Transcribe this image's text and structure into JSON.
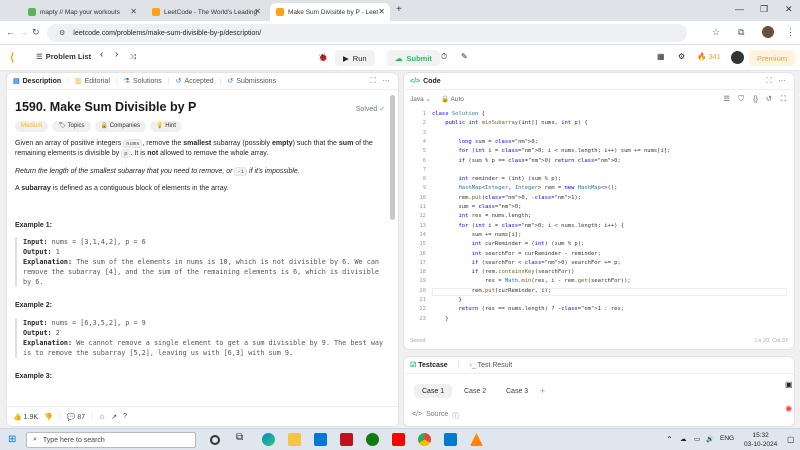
{
  "browser": {
    "tabs": [
      {
        "title": "mapty // Map your workouts",
        "active": false
      },
      {
        "title": "LeetCode - The World's Leading",
        "active": false
      },
      {
        "title": "Make Sum Divisible by P - Leet",
        "active": true
      }
    ],
    "new_tab": "+",
    "url": "leetcode.com/problems/make-sum-divisible-by-p/description/"
  },
  "lc_header": {
    "problem_list": "Problem List",
    "run": "Run",
    "submit": "Submit",
    "streak": "341",
    "premium": "Premium"
  },
  "left_tabs": [
    "Description",
    "Editorial",
    "Solutions",
    "Accepted",
    "Submissions"
  ],
  "problem": {
    "title": "1590. Make Sum Divisible by P",
    "status": "Solved",
    "chips": [
      "Medium",
      "Topics",
      "Companies",
      "Hint"
    ],
    "p1_a": "Given an array of positive integers ",
    "p1_code": "nums",
    "p1_b": ", remove the ",
    "p1_smallest": "smallest",
    "p1_c": " subarray (possibly ",
    "p1_empty": "empty",
    "p1_d": ") such that the ",
    "p1_sum": "sum",
    "p1_e": " of the remaining elements is divisible by ",
    "p1_p": "p",
    "p1_f": ". It is ",
    "p1_not": "not",
    "p1_g": " allowed to remove the whole array.",
    "p2_a": "Return the length of the smallest subarray that you need to remove, or ",
    "p2_code": "-1",
    "p2_b": " if it's impossible.",
    "p3_a": "A ",
    "p3_sub": "subarray",
    "p3_b": " is defined as a contiguous block of elements in the array.",
    "examples": [
      {
        "heading": "Example 1:",
        "input_label": "Input:",
        "input": " nums = [3,1,4,2], p = 6",
        "output_label": "Output:",
        "output": " 1",
        "expl_label": "Explanation:",
        "expl": " The sum of the elements in nums is 10, which is not divisible by 6. We can remove the subarray [4], and the sum of the remaining elements is 6, which is divisible by 6."
      },
      {
        "heading": "Example 2:",
        "input_label": "Input:",
        "input": " nums = [6,3,5,2], p = 9",
        "output_label": "Output:",
        "output": " 2",
        "expl_label": "Explanation:",
        "expl": " We cannot remove a single element to get a sum divisible by 9. The best way is to remove the subarray [5,2], leaving us with [6,3] with sum 9."
      }
    ],
    "example3_heading": "Example 3:",
    "likes": "1.9K",
    "comments": "87"
  },
  "code_panel": {
    "title": "Code",
    "language": "Java",
    "mode": "Auto",
    "line_numbers": [
      "1",
      "2",
      "3",
      "4",
      "5",
      "6",
      "7",
      "8",
      "9",
      "10",
      "11",
      "12",
      "13",
      "14",
      "15",
      "16",
      "17",
      "18",
      "19",
      "20",
      "21",
      "22",
      "23"
    ],
    "lines": [
      "class Solution {",
      "    public int minSubarray(int[] nums, int p) {",
      "",
      "        long sum = 0;",
      "        for (int i = 0; i < nums.length; i++) sum += nums[i];",
      "        if (sum % p == 0) return 0;",
      "",
      "        int reminder = (int) (sum % p);",
      "        HashMap<Integer, Integer> rem = new HashMap<>();",
      "        rem.put(0, -1);",
      "        sum = 0;",
      "        int res = nums.length;",
      "        for (int i = 0; i < nums.length; i++) {",
      "            sum += nums[i];",
      "            int curReminder = (int) (sum % p);",
      "            int searchFor = curReminder - reminder;",
      "            if (searchFor < 0) searchFor += p;",
      "            if (rem.containsKey(searchFor))",
      "                res = Math.min(res, i - rem.get(searchFor));",
      "            rem.put(curReminder, i);",
      "        }",
      "        return (res == nums.length) ? -1 : res;",
      "    }"
    ],
    "saved": "Saved",
    "cursor_pos": "Ln 20, Col 37"
  },
  "test_panel": {
    "tab_testcase": "Testcase",
    "tab_result": "Test Result",
    "cases": [
      "Case 1",
      "Case 2",
      "Case 3"
    ],
    "add": "+",
    "source": "Source"
  },
  "taskbar": {
    "search_placeholder": "Type here to search",
    "lang": "ENG",
    "time": "15:32",
    "date": "03-10-2024"
  },
  "colors": {
    "accent_orange": "#ffa116",
    "submit_green": "#2cbb5d",
    "medium_yellow": "#ffb800",
    "keyword_blue": "#0000ff"
  }
}
